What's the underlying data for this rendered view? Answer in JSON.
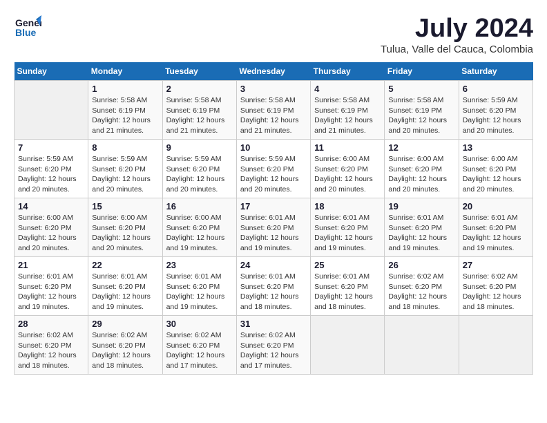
{
  "header": {
    "logo_line1": "General",
    "logo_line2": "Blue",
    "month": "July 2024",
    "location": "Tulua, Valle del Cauca, Colombia"
  },
  "weekdays": [
    "Sunday",
    "Monday",
    "Tuesday",
    "Wednesday",
    "Thursday",
    "Friday",
    "Saturday"
  ],
  "weeks": [
    [
      {
        "day": "",
        "info": ""
      },
      {
        "day": "1",
        "info": "Sunrise: 5:58 AM\nSunset: 6:19 PM\nDaylight: 12 hours and 21 minutes."
      },
      {
        "day": "2",
        "info": "Sunrise: 5:58 AM\nSunset: 6:19 PM\nDaylight: 12 hours and 21 minutes."
      },
      {
        "day": "3",
        "info": "Sunrise: 5:58 AM\nSunset: 6:19 PM\nDaylight: 12 hours and 21 minutes."
      },
      {
        "day": "4",
        "info": "Sunrise: 5:58 AM\nSunset: 6:19 PM\nDaylight: 12 hours and 21 minutes."
      },
      {
        "day": "5",
        "info": "Sunrise: 5:58 AM\nSunset: 6:19 PM\nDaylight: 12 hours and 20 minutes."
      },
      {
        "day": "6",
        "info": "Sunrise: 5:59 AM\nSunset: 6:20 PM\nDaylight: 12 hours and 20 minutes."
      }
    ],
    [
      {
        "day": "7",
        "info": "Sunrise: 5:59 AM\nSunset: 6:20 PM\nDaylight: 12 hours and 20 minutes."
      },
      {
        "day": "8",
        "info": "Sunrise: 5:59 AM\nSunset: 6:20 PM\nDaylight: 12 hours and 20 minutes."
      },
      {
        "day": "9",
        "info": "Sunrise: 5:59 AM\nSunset: 6:20 PM\nDaylight: 12 hours and 20 minutes."
      },
      {
        "day": "10",
        "info": "Sunrise: 5:59 AM\nSunset: 6:20 PM\nDaylight: 12 hours and 20 minutes."
      },
      {
        "day": "11",
        "info": "Sunrise: 6:00 AM\nSunset: 6:20 PM\nDaylight: 12 hours and 20 minutes."
      },
      {
        "day": "12",
        "info": "Sunrise: 6:00 AM\nSunset: 6:20 PM\nDaylight: 12 hours and 20 minutes."
      },
      {
        "day": "13",
        "info": "Sunrise: 6:00 AM\nSunset: 6:20 PM\nDaylight: 12 hours and 20 minutes."
      }
    ],
    [
      {
        "day": "14",
        "info": "Sunrise: 6:00 AM\nSunset: 6:20 PM\nDaylight: 12 hours and 20 minutes."
      },
      {
        "day": "15",
        "info": "Sunrise: 6:00 AM\nSunset: 6:20 PM\nDaylight: 12 hours and 20 minutes."
      },
      {
        "day": "16",
        "info": "Sunrise: 6:00 AM\nSunset: 6:20 PM\nDaylight: 12 hours and 19 minutes."
      },
      {
        "day": "17",
        "info": "Sunrise: 6:01 AM\nSunset: 6:20 PM\nDaylight: 12 hours and 19 minutes."
      },
      {
        "day": "18",
        "info": "Sunrise: 6:01 AM\nSunset: 6:20 PM\nDaylight: 12 hours and 19 minutes."
      },
      {
        "day": "19",
        "info": "Sunrise: 6:01 AM\nSunset: 6:20 PM\nDaylight: 12 hours and 19 minutes."
      },
      {
        "day": "20",
        "info": "Sunrise: 6:01 AM\nSunset: 6:20 PM\nDaylight: 12 hours and 19 minutes."
      }
    ],
    [
      {
        "day": "21",
        "info": "Sunrise: 6:01 AM\nSunset: 6:20 PM\nDaylight: 12 hours and 19 minutes."
      },
      {
        "day": "22",
        "info": "Sunrise: 6:01 AM\nSunset: 6:20 PM\nDaylight: 12 hours and 19 minutes."
      },
      {
        "day": "23",
        "info": "Sunrise: 6:01 AM\nSunset: 6:20 PM\nDaylight: 12 hours and 19 minutes."
      },
      {
        "day": "24",
        "info": "Sunrise: 6:01 AM\nSunset: 6:20 PM\nDaylight: 12 hours and 18 minutes."
      },
      {
        "day": "25",
        "info": "Sunrise: 6:01 AM\nSunset: 6:20 PM\nDaylight: 12 hours and 18 minutes."
      },
      {
        "day": "26",
        "info": "Sunrise: 6:02 AM\nSunset: 6:20 PM\nDaylight: 12 hours and 18 minutes."
      },
      {
        "day": "27",
        "info": "Sunrise: 6:02 AM\nSunset: 6:20 PM\nDaylight: 12 hours and 18 minutes."
      }
    ],
    [
      {
        "day": "28",
        "info": "Sunrise: 6:02 AM\nSunset: 6:20 PM\nDaylight: 12 hours and 18 minutes."
      },
      {
        "day": "29",
        "info": "Sunrise: 6:02 AM\nSunset: 6:20 PM\nDaylight: 12 hours and 18 minutes."
      },
      {
        "day": "30",
        "info": "Sunrise: 6:02 AM\nSunset: 6:20 PM\nDaylight: 12 hours and 17 minutes."
      },
      {
        "day": "31",
        "info": "Sunrise: 6:02 AM\nSunset: 6:20 PM\nDaylight: 12 hours and 17 minutes."
      },
      {
        "day": "",
        "info": ""
      },
      {
        "day": "",
        "info": ""
      },
      {
        "day": "",
        "info": ""
      }
    ]
  ]
}
